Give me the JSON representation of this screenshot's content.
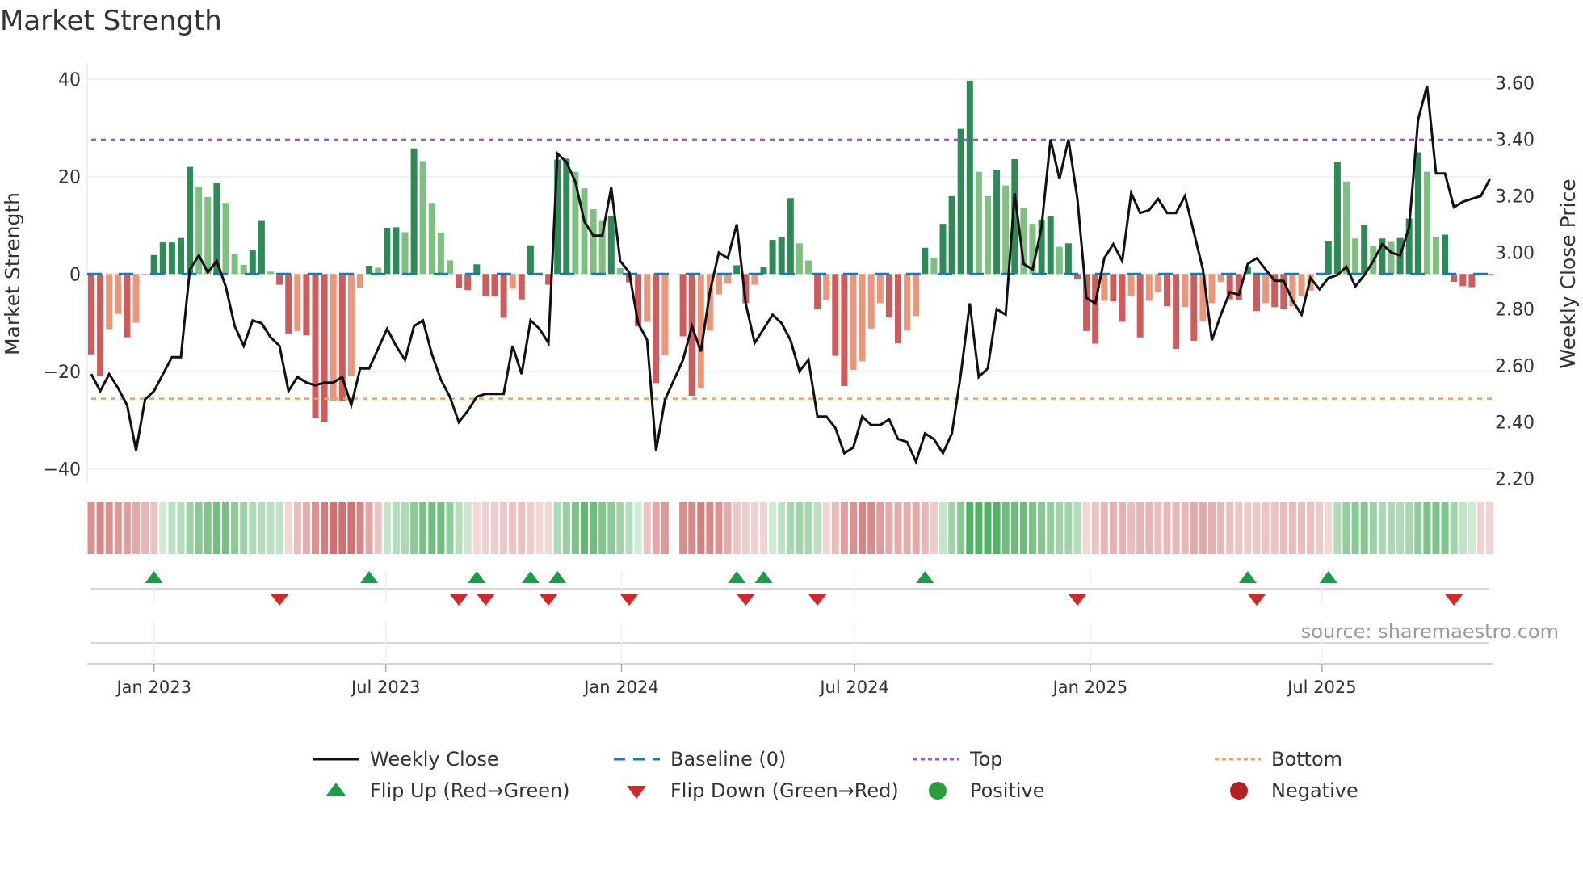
{
  "title": "Market Strength",
  "source": "source: sharemaestro.com",
  "colors": {
    "bar_up_strong": "#2e8b57",
    "bar_up_weak": "#7fbf7f",
    "bar_down_strong": "#cd5c5c",
    "bar_down_weak": "#e9967a",
    "weekly_close": "#111111",
    "baseline": "#1f77b4",
    "top": "#9b59d6",
    "bottom": "#f0a060",
    "flip_up": "#1a9c48",
    "flip_down": "#d62728",
    "positive": "#2a9d3a",
    "negative": "#b22222",
    "grid": "#eef0f4"
  },
  "legend": [
    {
      "label": "Weekly Close",
      "symbol": "line"
    },
    {
      "label": "Baseline (0)",
      "symbol": "dash"
    },
    {
      "label": "Top",
      "symbol": "dot-purple"
    },
    {
      "label": "Bottom",
      "symbol": "dot-orange"
    },
    {
      "label": "Flip Up (Red→Green)",
      "symbol": "triangle-up"
    },
    {
      "label": "Flip Down (Green→Red)",
      "symbol": "triangle-down"
    },
    {
      "label": "Positive",
      "symbol": "circle-green"
    },
    {
      "label": "Negative",
      "symbol": "circle-red"
    }
  ],
  "chart_data": {
    "type": "bar",
    "title": "Market Strength",
    "ylabel": "Market Strength",
    "y2label": "Weekly Close Price",
    "ylim": [
      -42,
      42
    ],
    "y2lim": [
      2.17,
      3.63
    ],
    "y_ticks": [
      "40",
      "20",
      "0",
      "−20",
      "−40"
    ],
    "y_tick_values": [
      40,
      20,
      0,
      -20,
      -40
    ],
    "y2_ticks": [
      "3.60",
      "3.40",
      "3.20",
      "3.00",
      "2.80",
      "2.60",
      "2.40",
      "2.20"
    ],
    "y2_tick_values": [
      3.6,
      3.4,
      3.2,
      3.0,
      2.8,
      2.6,
      2.4,
      2.2
    ],
    "x_start": "2022-11-13",
    "x_step_days": 7,
    "x_ticks": [
      {
        "label": "Jan 2023",
        "date": "2023-01-01"
      },
      {
        "label": "Jul 2023",
        "date": "2023-07-01"
      },
      {
        "label": "Jan 2024",
        "date": "2024-01-01"
      },
      {
        "label": "Jul 2024",
        "date": "2024-07-01"
      },
      {
        "label": "Jan 2025",
        "date": "2025-01-01"
      },
      {
        "label": "Jul 2025",
        "date": "2025-07-01"
      }
    ],
    "top_level": 27.6,
    "bottom_level": -25.6,
    "baseline": 0,
    "strength": [
      -16.5,
      -21,
      -11.3,
      -8.2,
      -13,
      -10,
      -0.2,
      3.9,
      6.5,
      6.5,
      7.4,
      22,
      17.8,
      15.8,
      18.8,
      14.6,
      4.1,
      1.9,
      4.9,
      10.9,
      0.5,
      -2.2,
      -12.2,
      -11.7,
      -12.6,
      -29.5,
      -30.3,
      -26,
      -26,
      -21,
      -2.8,
      1.7,
      1.3,
      9.5,
      9.6,
      8.6,
      25.8,
      23.2,
      14.6,
      8.5,
      2.8,
      -2.8,
      -3.3,
      2,
      -4.5,
      -4.6,
      -9,
      -3,
      -5.2,
      5.9,
      0.1,
      -2.2,
      23.5,
      23.7,
      21,
      17.6,
      13.3,
      10.9,
      11.9,
      1.2,
      -1.7,
      -10.7,
      -9.8,
      -22.4,
      -16.7,
      null,
      -12.8,
      -25,
      -23.5,
      -11.6,
      -4.2,
      -2,
      1.8,
      -6,
      -2.2,
      1.4,
      7,
      7.6,
      15.6,
      6.3,
      2.8,
      -7.2,
      -5.4,
      -16.8,
      -23,
      -19.7,
      -17.9,
      -11.2,
      -6,
      -8.9,
      -14.2,
      -11.6,
      -8.6,
      5.4,
      3.2,
      10.3,
      16,
      29.8,
      39.7,
      21,
      16,
      21.3,
      18.2,
      23.6,
      13.6,
      10.3,
      11.2,
      11.9,
      5.6,
      6.3,
      -1,
      -11.7,
      -14.3,
      -5.5,
      -5.6,
      -9.8,
      -4.5,
      -13,
      -5.5,
      -3.7,
      -6.6,
      -15.4,
      -6.8,
      -13.7,
      -9.6,
      -6,
      -1.6,
      -5.2,
      -5.3,
      1.5,
      -7.6,
      -6,
      -6.8,
      -7.2,
      -6.6,
      -4.5,
      -3.4,
      -0.2,
      6.7,
      23,
      19,
      7.3,
      10,
      5.8,
      7.3,
      6.6,
      7.4,
      11.4,
      25,
      21,
      7.6,
      8.1,
      -1.6,
      -2.5,
      -2.7,
      -0.1,
      -0.3
    ],
    "weekly_close": [
      2.57,
      2.51,
      2.57,
      2.52,
      2.46,
      2.3,
      2.48,
      2.51,
      2.57,
      2.63,
      2.63,
      2.94,
      2.99,
      2.93,
      2.97,
      2.88,
      2.74,
      2.67,
      2.76,
      2.75,
      2.7,
      2.67,
      2.51,
      2.56,
      2.54,
      2.53,
      2.54,
      2.54,
      2.56,
      2.46,
      2.59,
      2.59,
      2.66,
      2.73,
      2.67,
      2.62,
      2.74,
      2.76,
      2.64,
      2.55,
      2.49,
      2.4,
      2.44,
      2.49,
      2.5,
      2.5,
      2.5,
      2.67,
      2.57,
      2.76,
      2.73,
      2.68,
      3.35,
      3.32,
      3.25,
      3.11,
      3.06,
      3.06,
      3.23,
      2.97,
      2.93,
      2.75,
      2.69,
      2.3,
      2.48,
      2.55,
      2.62,
      2.74,
      2.65,
      2.86,
      3.0,
      2.98,
      3.1,
      2.82,
      2.68,
      2.73,
      2.78,
      2.75,
      2.69,
      2.58,
      2.62,
      2.42,
      2.42,
      2.38,
      2.29,
      2.31,
      2.42,
      2.39,
      2.39,
      2.41,
      2.34,
      2.33,
      2.26,
      2.36,
      2.34,
      2.29,
      2.36,
      2.57,
      2.82,
      2.56,
      2.59,
      2.8,
      2.78,
      3.21,
      2.96,
      2.94,
      3.09,
      3.4,
      3.26,
      3.4,
      3.19,
      2.84,
      2.82,
      2.98,
      3.03,
      2.97,
      3.21,
      3.14,
      3.15,
      3.19,
      3.14,
      3.14,
      3.2,
      3.07,
      2.94,
      2.69,
      2.78,
      2.86,
      2.85,
      2.96,
      2.98,
      2.94,
      2.9,
      2.9,
      2.83,
      2.78,
      2.91,
      2.87,
      2.91,
      2.92,
      2.95,
      2.88,
      2.92,
      2.97,
      3.03,
      3.0,
      2.99,
      3.09,
      3.47,
      3.59,
      3.28,
      3.28,
      3.16,
      3.18,
      3.19,
      3.2,
      3.26
    ],
    "flip_up_weeks": [
      7,
      31,
      43,
      49,
      52,
      72,
      75,
      93,
      129,
      138
    ],
    "flip_down_weeks": [
      21,
      41,
      44,
      51,
      60,
      73,
      81,
      110,
      130,
      152
    ]
  }
}
